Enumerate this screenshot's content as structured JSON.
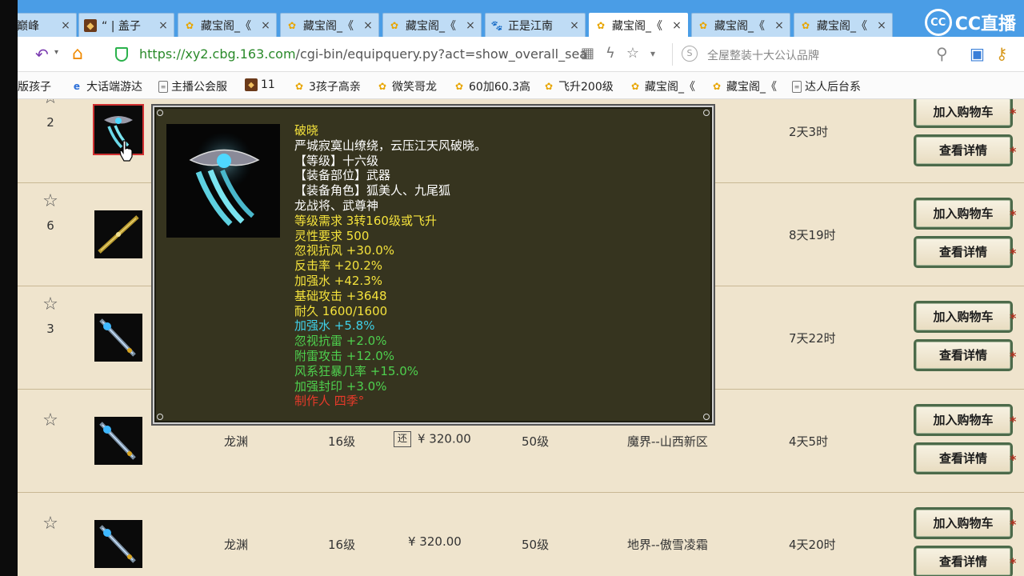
{
  "tabs": [
    {
      "label": "操巅峰",
      "icon": "none",
      "active": false
    },
    {
      "label": "“ | 盖子",
      "icon": "game-icon",
      "active": false
    },
    {
      "label": "藏宝阁_《",
      "icon": "cbg-icon",
      "active": false
    },
    {
      "label": "藏宝阁_《",
      "icon": "cbg-icon",
      "active": false
    },
    {
      "label": "藏宝阁_《",
      "icon": "cbg-icon",
      "active": false
    },
    {
      "label": "正是江南",
      "icon": "baidu-icon",
      "active": false
    },
    {
      "label": "藏宝阁_《",
      "icon": "cbg-icon",
      "active": true
    },
    {
      "label": "藏宝阁_《",
      "icon": "cbg-icon",
      "active": false
    },
    {
      "label": "藏宝阁_《",
      "icon": "cbg-icon",
      "active": false
    }
  ],
  "watermark": "CC直播",
  "address": {
    "url_host": "https://xy2.cbg.163.com",
    "url_path": "/cgi-bin/equipquery.py?act=show_overall_sea",
    "search_placeholder": "全屋整装十大公认品牌"
  },
  "bookmarks": [
    {
      "label": "版孩子",
      "icon": "none"
    },
    {
      "label": "大话端游达",
      "icon": "ie-icon"
    },
    {
      "label": "主播公会服",
      "icon": "doc-icon"
    },
    {
      "label": "11",
      "icon": "game-icon"
    },
    {
      "label": "3孩子高亲",
      "icon": "cbg-icon"
    },
    {
      "label": "微笑哥龙",
      "icon": "cbg-icon"
    },
    {
      "label": "60加60.3高",
      "icon": "cbg-icon"
    },
    {
      "label": "飞升200级",
      "icon": "cbg-icon"
    },
    {
      "label": "藏宝阁_《",
      "icon": "cbg-icon"
    },
    {
      "label": "藏宝阁_《",
      "icon": "cbg-icon"
    },
    {
      "label": "达人后台系",
      "icon": "doc-icon"
    }
  ],
  "buttons": {
    "add_cart": "加入购物车",
    "details": "查看详情"
  },
  "rows": [
    {
      "fav_count": "2",
      "name": "",
      "level": "",
      "price": "",
      "has_return": false,
      "char_level": "",
      "server": "",
      "time_left": "2天3时"
    },
    {
      "fav_count": "6",
      "name": "",
      "level": "",
      "price": "",
      "has_return": false,
      "char_level": "",
      "server": "",
      "time_left": "8天19时"
    },
    {
      "fav_count": "3",
      "name": "",
      "level": "",
      "price": "",
      "has_return": false,
      "char_level": "",
      "server": "",
      "time_left": "7天22时"
    },
    {
      "fav_count": "",
      "name": "龙渊",
      "level": "16级",
      "price": "¥ 320.00",
      "has_return": true,
      "return_label": "还",
      "char_level": "50级",
      "server": "魔界--山西新区",
      "time_left": "4天5时"
    },
    {
      "fav_count": "",
      "name": "龙渊",
      "level": "16级",
      "price": "¥ 320.00",
      "has_return": false,
      "char_level": "50级",
      "server": "地界--傲雪凌霜",
      "time_left": "4天20时"
    }
  ],
  "tooltip": {
    "lines": [
      {
        "text": "破晓",
        "color": "#f4e23c"
      },
      {
        "text": "严城寂寞山缭绕，云压江天风破晓。",
        "color": "#ffffff"
      },
      {
        "text": "【等级】十六级",
        "color": "#ffffff"
      },
      {
        "text": "【装备部位】武器",
        "color": "#ffffff"
      },
      {
        "text": "【装备角色】狐美人、九尾狐",
        "color": "#ffffff"
      },
      {
        "text": "龙战将、武尊神",
        "color": "#ffffff"
      },
      {
        "text": "等级需求 3转160级或飞升",
        "color": "#f4e23c"
      },
      {
        "text": "灵性要求 500",
        "color": "#f4e23c"
      },
      {
        "text": "忽视抗风 +30.0%",
        "color": "#f4e23c"
      },
      {
        "text": "反击率 +20.2%",
        "color": "#f4e23c"
      },
      {
        "text": "加强水 +42.3%",
        "color": "#f4e23c"
      },
      {
        "text": "基础攻击 +3648",
        "color": "#f4e23c"
      },
      {
        "text": "耐久 1600/1600",
        "color": "#f4e23c"
      },
      {
        "text": "加强水 +5.8%",
        "color": "#3fd0e8"
      },
      {
        "text": "忽视抗雷 +2.0%",
        "color": "#4ed04e"
      },
      {
        "text": "附雷攻击 +12.0%",
        "color": "#4ed04e"
      },
      {
        "text": "风系狂暴几率 +15.0%",
        "color": "#4ed04e"
      },
      {
        "text": "加强封印 +3.0%",
        "color": "#4ed04e"
      },
      {
        "text": "制作人 四季°",
        "color": "#e83a2a"
      }
    ]
  }
}
